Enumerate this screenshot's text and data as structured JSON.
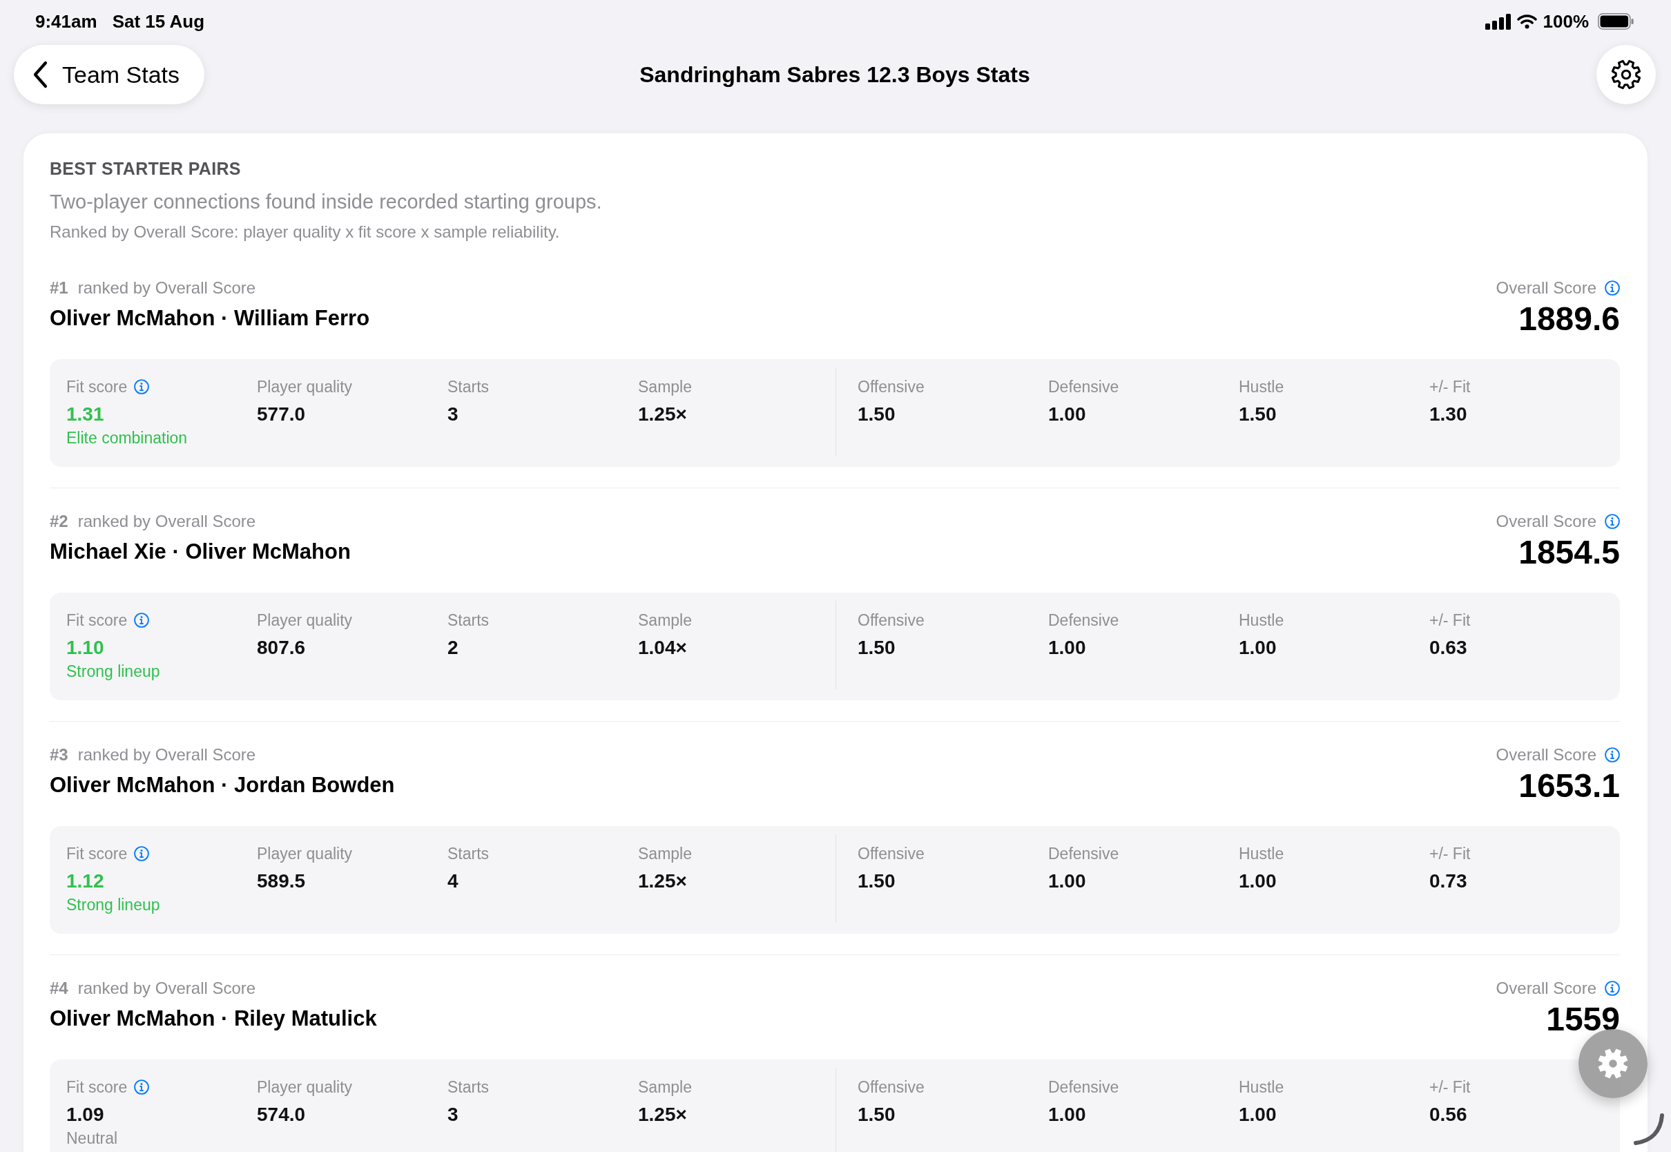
{
  "status_bar": {
    "time": "9:41am",
    "date": "Sat 15 Aug",
    "battery": "100%"
  },
  "nav": {
    "back_label": "Team Stats",
    "title": "Sandringham Sabres 12.3 Boys Stats"
  },
  "section": {
    "title": "BEST STARTER PAIRS",
    "subtitle": "Two-player connections found inside recorded starting groups.",
    "note": "Ranked by Overall Score: player quality x fit score x sample reliability."
  },
  "pairs": [
    {
      "rank": "#1",
      "rank_caption": "ranked by Overall Score",
      "players": "Oliver McMahon · William Ferro",
      "score_label": "Overall Score",
      "score": "1889.6",
      "fit": {
        "label": "Fit score",
        "value": "1.31",
        "verdict": "Elite combination",
        "positive": true
      },
      "metrics": [
        {
          "label": "Player quality",
          "value": "577.0"
        },
        {
          "label": "Starts",
          "value": "3"
        },
        {
          "label": "Sample",
          "value": "1.25×"
        }
      ],
      "ratings": [
        {
          "label": "Offensive",
          "value": "1.50"
        },
        {
          "label": "Defensive",
          "value": "1.00"
        },
        {
          "label": "Hustle",
          "value": "1.50"
        },
        {
          "label": "+/- Fit",
          "value": "1.30"
        }
      ]
    },
    {
      "rank": "#2",
      "rank_caption": "ranked by Overall Score",
      "players": "Michael Xie · Oliver McMahon",
      "score_label": "Overall Score",
      "score": "1854.5",
      "fit": {
        "label": "Fit score",
        "value": "1.10",
        "verdict": "Strong lineup",
        "positive": true
      },
      "metrics": [
        {
          "label": "Player quality",
          "value": "807.6"
        },
        {
          "label": "Starts",
          "value": "2"
        },
        {
          "label": "Sample",
          "value": "1.04×"
        }
      ],
      "ratings": [
        {
          "label": "Offensive",
          "value": "1.50"
        },
        {
          "label": "Defensive",
          "value": "1.00"
        },
        {
          "label": "Hustle",
          "value": "1.00"
        },
        {
          "label": "+/- Fit",
          "value": "0.63"
        }
      ]
    },
    {
      "rank": "#3",
      "rank_caption": "ranked by Overall Score",
      "players": "Oliver McMahon · Jordan Bowden",
      "score_label": "Overall Score",
      "score": "1653.1",
      "fit": {
        "label": "Fit score",
        "value": "1.12",
        "verdict": "Strong lineup",
        "positive": true
      },
      "metrics": [
        {
          "label": "Player quality",
          "value": "589.5"
        },
        {
          "label": "Starts",
          "value": "4"
        },
        {
          "label": "Sample",
          "value": "1.25×"
        }
      ],
      "ratings": [
        {
          "label": "Offensive",
          "value": "1.50"
        },
        {
          "label": "Defensive",
          "value": "1.00"
        },
        {
          "label": "Hustle",
          "value": "1.00"
        },
        {
          "label": "+/- Fit",
          "value": "0.73"
        }
      ]
    },
    {
      "rank": "#4",
      "rank_caption": "ranked by Overall Score",
      "players": "Oliver McMahon · Riley Matulick",
      "score_label": "Overall Score",
      "score": "1559",
      "fit": {
        "label": "Fit score",
        "value": "1.09",
        "verdict": "Neutral",
        "positive": false
      },
      "metrics": [
        {
          "label": "Player quality",
          "value": "574.0"
        },
        {
          "label": "Starts",
          "value": "3"
        },
        {
          "label": "Sample",
          "value": "1.25×"
        }
      ],
      "ratings": [
        {
          "label": "Offensive",
          "value": "1.50"
        },
        {
          "label": "Defensive",
          "value": "1.00"
        },
        {
          "label": "Hustle",
          "value": "1.00"
        },
        {
          "label": "+/- Fit",
          "value": "0.56"
        }
      ]
    }
  ]
}
